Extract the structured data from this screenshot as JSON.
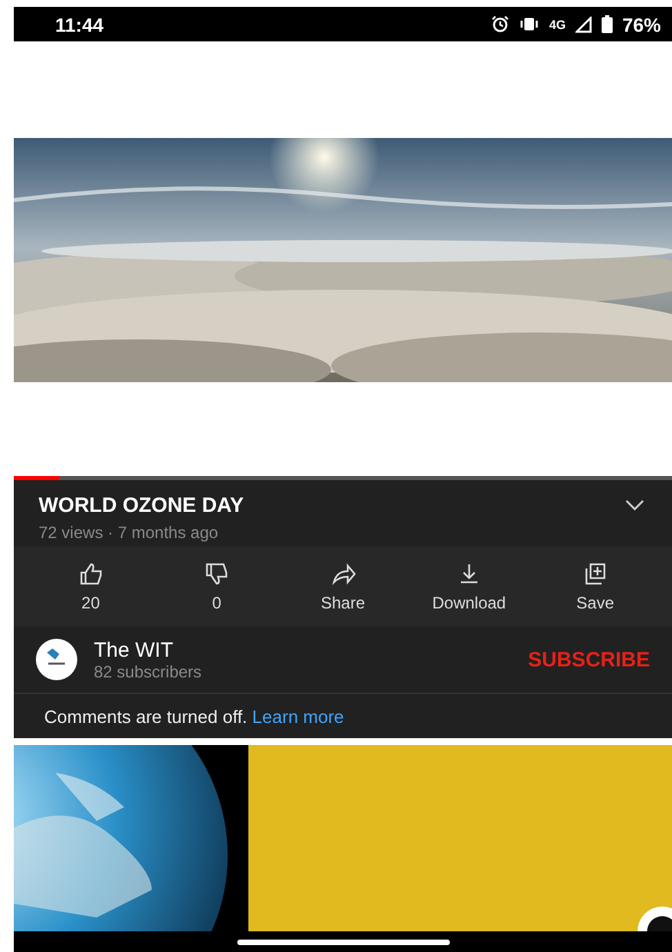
{
  "status_bar": {
    "time": "11:44",
    "network": "4G",
    "battery": "76%"
  },
  "player": {
    "kind": "picture",
    "progress": {
      "level": 0.07
    }
  },
  "video": {
    "title": "WORLD OZONE DAY",
    "meta": "72 views · 7 months ago",
    "expanded": false
  },
  "actions": [
    {
      "kind": "like",
      "label": "20"
    },
    {
      "kind": "dislike",
      "label": "0"
    },
    {
      "kind": "share",
      "label": "Share"
    },
    {
      "kind": "download",
      "label": "Download"
    },
    {
      "kind": "save",
      "label": "Save"
    }
  ],
  "channel": {
    "name": "The WIT",
    "subscribers": "82 subscribers",
    "subscribe": "SUBSCRIBE"
  },
  "comments": {
    "text": "Comments are turned off.",
    "link": "Learn more"
  }
}
